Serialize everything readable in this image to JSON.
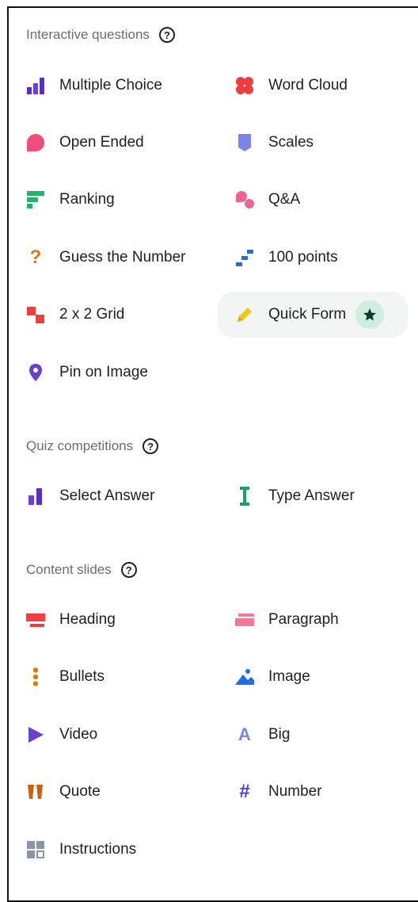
{
  "sections": {
    "interactive": {
      "title": "Interactive questions",
      "items": [
        {
          "label": "Multiple Choice",
          "icon": "multiple-choice-icon"
        },
        {
          "label": "Word Cloud",
          "icon": "word-cloud-icon"
        },
        {
          "label": "Open Ended",
          "icon": "open-ended-icon"
        },
        {
          "label": "Scales",
          "icon": "scales-icon"
        },
        {
          "label": "Ranking",
          "icon": "ranking-icon"
        },
        {
          "label": "Q&A",
          "icon": "qa-icon"
        },
        {
          "label": "Guess the Number",
          "icon": "question-mark-icon"
        },
        {
          "label": "100 points",
          "icon": "hundred-points-icon"
        },
        {
          "label": "2 x 2 Grid",
          "icon": "grid-icon"
        },
        {
          "label": "Quick Form",
          "icon": "pencil-icon"
        },
        {
          "label": "Pin on Image",
          "icon": "map-pin-icon"
        }
      ]
    },
    "quiz": {
      "title": "Quiz competitions",
      "items": [
        {
          "label": "Select Answer",
          "icon": "select-answer-icon"
        },
        {
          "label": "Type Answer",
          "icon": "text-cursor-icon"
        }
      ]
    },
    "content": {
      "title": "Content slides",
      "items": [
        {
          "label": "Heading",
          "icon": "heading-icon"
        },
        {
          "label": "Paragraph",
          "icon": "paragraph-icon"
        },
        {
          "label": "Bullets",
          "icon": "bullets-icon"
        },
        {
          "label": "Image",
          "icon": "image-icon"
        },
        {
          "label": "Video",
          "icon": "play-icon"
        },
        {
          "label": "Big",
          "icon": "big-letter-icon"
        },
        {
          "label": "Quote",
          "icon": "quote-icon"
        },
        {
          "label": "Number",
          "icon": "hash-icon"
        },
        {
          "label": "Instructions",
          "icon": "instructions-icon"
        }
      ]
    }
  },
  "help_glyph": "?",
  "big_glyph": "A",
  "number_glyph": "#",
  "question_glyph": "?"
}
